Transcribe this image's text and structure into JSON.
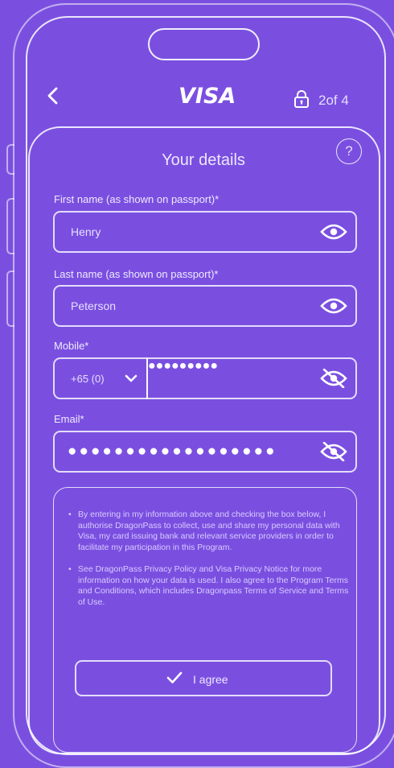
{
  "header": {
    "back_icon": "chevron-left-icon",
    "logo": "VISA",
    "lock_icon": "lock-icon",
    "step": "2of 4"
  },
  "card": {
    "title": "Your details",
    "help": "?"
  },
  "form": {
    "first_name": {
      "label": "First name (as shown on passport)*",
      "value": "Henry",
      "icon": "eye-icon"
    },
    "last_name": {
      "label": "Last name (as shown on passport)*",
      "value": "Peterson",
      "icon": "eye-icon"
    },
    "mobile": {
      "label": "Mobile*",
      "country_code": "+65 (0)",
      "value": "●●●●●●●●●",
      "icon": "eye-off-icon"
    },
    "email": {
      "label": "Email*",
      "value": "●●●●●●●●●●●●●●●●●●",
      "icon": "eye-off-icon"
    }
  },
  "terms": {
    "items": [
      "By entering in my information above and checking the box below, I authorise DragonPass to collect, use and share my personal data with Visa, my card issuing bank and relevant service providers in order to facilitate my participation in this Program.",
      "See DragonPass Privacy Policy and Visa Privacy Notice for more information on how your data is used. I also agree to the Program Terms and Conditions, which includes Dragonpass Terms of Service and Terms of Use."
    ],
    "agree_label": "I agree"
  },
  "colors": {
    "background": "#7a4fe0",
    "stroke": "#ffffff"
  }
}
